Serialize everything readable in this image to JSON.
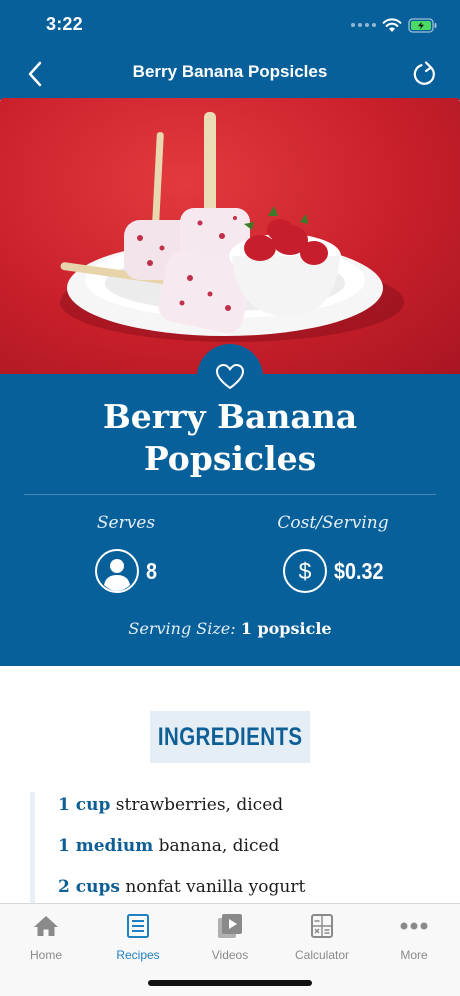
{
  "status": {
    "time": "3:22"
  },
  "nav": {
    "title": "Berry Banana Popsicles"
  },
  "recipe": {
    "title": "Berry Banana Popsicles",
    "serves_label": "Serves",
    "serves_value": "8",
    "cost_label": "Cost/Serving",
    "cost_value": "$0.32",
    "serving_size_label": "Serving Size:",
    "serving_size_value": "1 popsicle"
  },
  "ingredients": {
    "header": "INGREDIENTS",
    "items": [
      {
        "qty": "1 cup",
        "name": "strawberries, diced"
      },
      {
        "qty": "1 medium",
        "name": "banana, diced"
      },
      {
        "qty": "2 cups",
        "name": "nonfat vanilla yogurt"
      }
    ]
  },
  "tabs": [
    {
      "label": "Home",
      "icon": "home-icon"
    },
    {
      "label": "Recipes",
      "icon": "recipes-icon",
      "active": true
    },
    {
      "label": "Videos",
      "icon": "videos-icon"
    },
    {
      "label": "Calculator",
      "icon": "calculator-icon"
    },
    {
      "label": "More",
      "icon": "more-icon"
    }
  ],
  "colors": {
    "primary": "#08609a",
    "accent": "#1e7fc2",
    "hero_background": "#c9202b",
    "ingredient_qty": "#0e5f95"
  }
}
